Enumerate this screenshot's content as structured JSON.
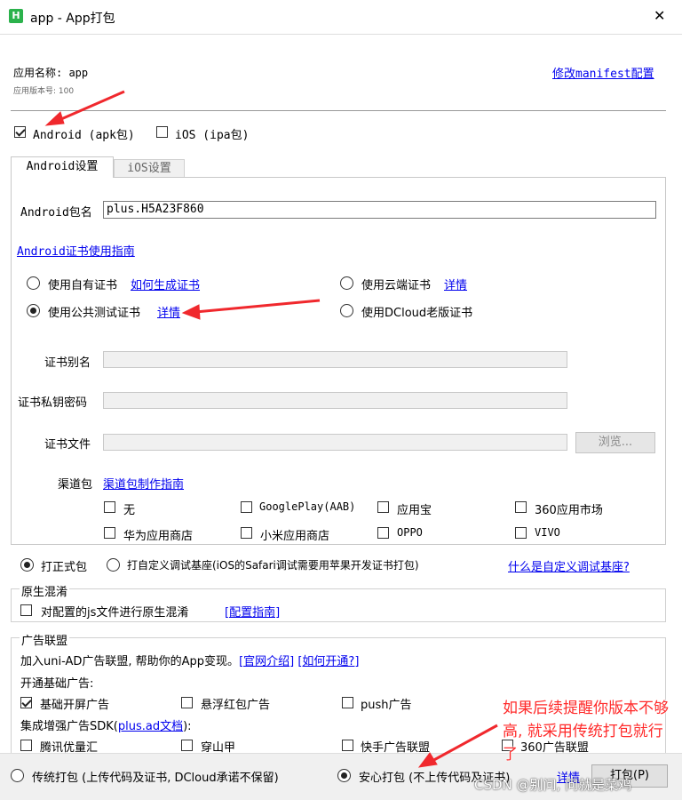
{
  "window": {
    "title": "app - App打包",
    "close_glyph": "✕"
  },
  "header": {
    "app_name": "应用名称: app",
    "app_version": "应用版本号: 100",
    "manifest_link": "修改manifest配置"
  },
  "platforms": {
    "android_label": "Android (apk包)",
    "android_checked": true,
    "ios_label": "iOS (ipa包)",
    "ios_checked": false
  },
  "tabs": [
    {
      "label": "Android设置",
      "active": true
    },
    {
      "label": "iOS设置",
      "active": false
    }
  ],
  "android": {
    "package_label": "Android包名",
    "package_value": "plus.H5A23F860",
    "cert_guide_link": "Android证书使用指南",
    "cert_options": {
      "own": {
        "label": "使用自有证书",
        "link": "如何生成证书",
        "checked": false
      },
      "cloud": {
        "label": "使用云端证书",
        "link": "详情",
        "checked": false
      },
      "public": {
        "label": "使用公共测试证书",
        "link": "详情",
        "checked": true
      },
      "dcloud_old": {
        "label": "使用DCloud老版证书",
        "checked": false
      }
    },
    "alias_label": "证书别名",
    "password_label": "证书私钥密码",
    "file_label": "证书文件",
    "browse_button": "浏览...",
    "channel_label": "渠道包",
    "channel_link": "渠道包制作指南",
    "channels": [
      {
        "label": "无",
        "checked": false
      },
      {
        "label": "GooglePlay(AAB)",
        "checked": false
      },
      {
        "label": "应用宝",
        "checked": false
      },
      {
        "label": "360应用市场",
        "checked": false
      },
      {
        "label": "华为应用商店",
        "checked": false
      },
      {
        "label": "小米应用商店",
        "checked": false
      },
      {
        "label": "OPPO",
        "checked": false
      },
      {
        "label": "VIVO",
        "checked": false
      }
    ]
  },
  "build_mode": {
    "formal_label": "打正式包",
    "formal_checked": true,
    "custom_label": "打自定义调试基座(iOS的Safari调试需要用苹果开发证书打包)",
    "custom_checked": false,
    "custom_link": "什么是自定义调试基座?"
  },
  "obfuscation": {
    "title": "原生混淆",
    "option_label": "对配置的js文件进行原生混淆",
    "option_checked": false,
    "guide_link": "[配置指南]"
  },
  "ads": {
    "title": "广告联盟",
    "intro": "加入uni-AD广告联盟, 帮助你的App变现。",
    "official_link": "[官网介绍]",
    "howto_link": "[如何开通?]",
    "basic_title": "开通基础广告:",
    "basic_items": [
      {
        "label": "基础开屏广告",
        "checked": true
      },
      {
        "label": "悬浮红包广告",
        "checked": false
      },
      {
        "label": "push广告",
        "checked": false
      }
    ],
    "enhanced_prefix": "集成增强广告SDK(",
    "enhanced_link": "plus.ad文档",
    "enhanced_suffix": "):",
    "enhanced_items": [
      {
        "label": "腾讯优量汇",
        "checked": false
      },
      {
        "label": "穿山甲",
        "checked": false
      },
      {
        "label": "快手广告联盟",
        "checked": false
      },
      {
        "label": "360广告联盟",
        "checked": false
      }
    ]
  },
  "footer": {
    "traditional_label": "传统打包 (上传代码及证书, DCloud承诺不保留)",
    "traditional_checked": false,
    "safe_label": "安心打包 (不上传代码及证书)",
    "safe_checked": true,
    "safe_link": "详情",
    "pack_button": "打包(P)"
  },
  "annotation": {
    "text": "如果后续提醒你版本不够高, 就采用传统打包就行了",
    "color": "#ff2a2a"
  },
  "watermark": "CSDN @别问, 问就是菜鸡",
  "colors": {
    "accent": "#0000ee",
    "icon_green": "#2bb24c",
    "arrow_red": "#f0282d"
  }
}
